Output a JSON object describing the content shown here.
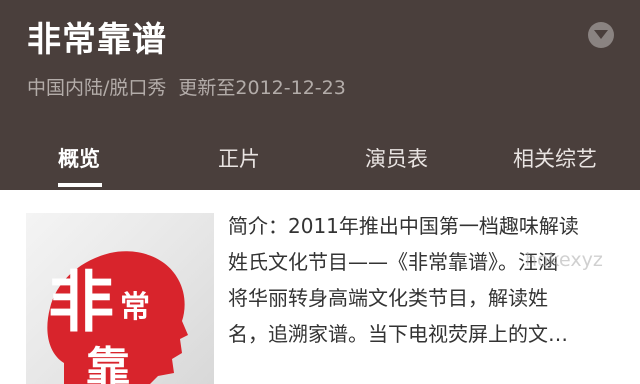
{
  "header": {
    "title": "非常靠谱",
    "meta_region_genre": "中国内陆/脱口秀",
    "meta_updated": "更新至2012-12-23",
    "expand_icon": "chevron-down-icon"
  },
  "tabs": [
    {
      "label": "概览",
      "active": true
    },
    {
      "label": "正片",
      "active": false
    },
    {
      "label": "演员表",
      "active": false
    },
    {
      "label": "相关综艺",
      "active": false
    }
  ],
  "poster": {
    "chars": [
      "非",
      "常",
      "靠"
    ]
  },
  "description": {
    "lines": [
      "简介：2011年推出中国第一档趣味解读",
      "姓氏文化节目——《非常靠谱》。汪涵",
      "将华丽转身高端文化类节目，解读姓",
      "名，追溯家谱。当下电视荧屏上的文…"
    ]
  },
  "watermark": "hokexyz",
  "colors": {
    "header_bg": "#4a3f3c",
    "poster_red": "#d8242c"
  }
}
